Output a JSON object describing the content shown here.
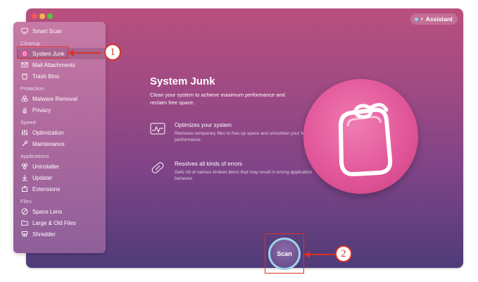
{
  "window": {
    "assistant_label": "Assistant"
  },
  "sidebar": {
    "items": [
      {
        "label": "Smart Scan",
        "icon": "monitor-icon"
      },
      {
        "label": "System Junk",
        "icon": "system-junk-icon",
        "active": true
      },
      {
        "label": "Mail Attachments",
        "icon": "mail-icon"
      },
      {
        "label": "Trash Bins",
        "icon": "trash-icon"
      },
      {
        "label": "Malware Removal",
        "icon": "biohazard-icon"
      },
      {
        "label": "Privacy",
        "icon": "hand-icon"
      },
      {
        "label": "Optimization",
        "icon": "sliders-icon"
      },
      {
        "label": "Maintenance",
        "icon": "wrench-icon"
      },
      {
        "label": "Uninstaller",
        "icon": "uninstaller-icon"
      },
      {
        "label": "Updater",
        "icon": "updater-icon"
      },
      {
        "label": "Extensions",
        "icon": "extensions-icon"
      },
      {
        "label": "Space Lens",
        "icon": "space-lens-icon"
      },
      {
        "label": "Large & Old Files",
        "icon": "folder-icon"
      },
      {
        "label": "Shredder",
        "icon": "shredder-icon"
      }
    ],
    "sections": [
      "Cleanup",
      "Protection",
      "Speed",
      "Applications",
      "Files"
    ]
  },
  "main": {
    "title": "System Junk",
    "description": "Clean your system to achieve maximum performance and reclaim free space.",
    "features": [
      {
        "title": "Optimizes your system",
        "desc": "Removes temporary files to free up space and smoothen your Mac's performance."
      },
      {
        "title": "Resolves all kinds of errors",
        "desc": "Gets rid of various broken items that may result in wrong application behavior."
      }
    ],
    "scan_label": "Scan"
  },
  "annotations": {
    "marker1": "1",
    "marker2": "2"
  },
  "colors": {
    "annotation_red": "#d9332a",
    "scan_ring": "#9ed3e6"
  }
}
